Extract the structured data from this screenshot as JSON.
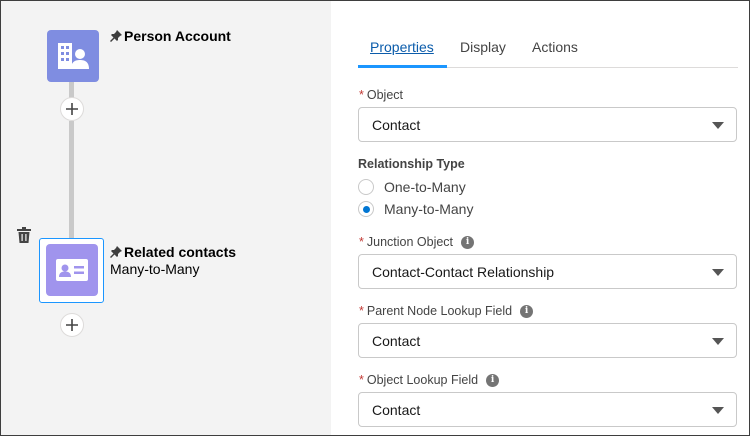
{
  "canvas": {
    "nodes": [
      {
        "title": "Person Account",
        "subtitle": "",
        "icon": "person-account-icon",
        "color": "#7f8de1"
      },
      {
        "title": "Related contacts",
        "subtitle": "Many-to-Many",
        "icon": "contact-card-icon",
        "color": "#a094ed"
      }
    ],
    "add_icon": "plus-icon",
    "delete_icon": "trash-icon",
    "pin_icon": "pin-icon"
  },
  "panel": {
    "tabs": [
      {
        "label": "Properties",
        "active": true
      },
      {
        "label": "Display",
        "active": false
      },
      {
        "label": "Actions",
        "active": false
      }
    ],
    "object": {
      "label": "Object",
      "required": true,
      "value": "Contact"
    },
    "relationship_type": {
      "label": "Relationship Type",
      "options": [
        {
          "label": "One-to-Many",
          "selected": false
        },
        {
          "label": "Many-to-Many",
          "selected": true
        }
      ]
    },
    "junction_object": {
      "label": "Junction Object",
      "required": true,
      "value": "Contact-Contact Relationship"
    },
    "parent_lookup": {
      "label": "Parent Node Lookup Field",
      "required": true,
      "value": "Contact"
    },
    "object_lookup": {
      "label": "Object Lookup Field",
      "required": true,
      "value": "Contact"
    },
    "required_mark": "*",
    "info_glyph": "i"
  },
  "colors": {
    "accent": "#1b96ff",
    "link": "#0b5cab",
    "radio": "#0176d3",
    "required": "#c23934"
  }
}
